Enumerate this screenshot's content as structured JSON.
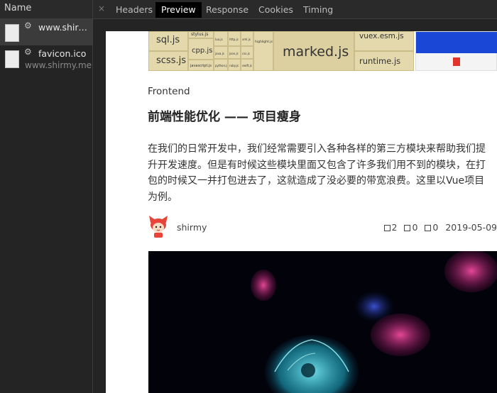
{
  "left_panel": {
    "header": "Name",
    "requests": [
      {
        "name": "www.shirm...",
        "domain": ""
      },
      {
        "name": "favicon.ico",
        "domain": "www.shirmy.me"
      }
    ]
  },
  "tabs": [
    "Headers",
    "Preview",
    "Response",
    "Cookies",
    "Timing"
  ],
  "active_tab": "Preview",
  "treemap_labels": {
    "sql": "sql.js",
    "scss": "scss.js",
    "stylus": "stylus.js",
    "cpp": "cpp.js",
    "marked": "marked.js",
    "vuex": "vuex.esm.js",
    "runtime": "runtime.js",
    "javascript": "javascript.js",
    "java": "java.js",
    "python": "python.js",
    "highlight": "highlight.js",
    "json": "json.js",
    "xml": "xml.js",
    "swift": "swift.js",
    "css": "css.js",
    "nginx": "nginx.js",
    "lua": "lua.js",
    "http": "http.js",
    "ruby": "ruby.js"
  },
  "article": {
    "category": "Frontend",
    "title": "前端性能优化 —— 项目瘦身",
    "excerpt": "在我们的日常开发中，我们经常需要引入各种各样的第三方模块来帮助我们提升开发速度。但是有时候这些模块里面又包含了许多我们用不到的模块，在打包的时候又一并打包进去了，这就造成了没必要的带宽浪费。这里以Vue项目为例。",
    "author": "shirmy",
    "stats": [
      "2",
      "0",
      "0"
    ],
    "date": "2019-05-09"
  },
  "colors": {
    "panel_bg": "#242424",
    "active_tab_bg": "#000000",
    "treemap": "#e4d9ac",
    "page_bg": "#ffffff"
  }
}
